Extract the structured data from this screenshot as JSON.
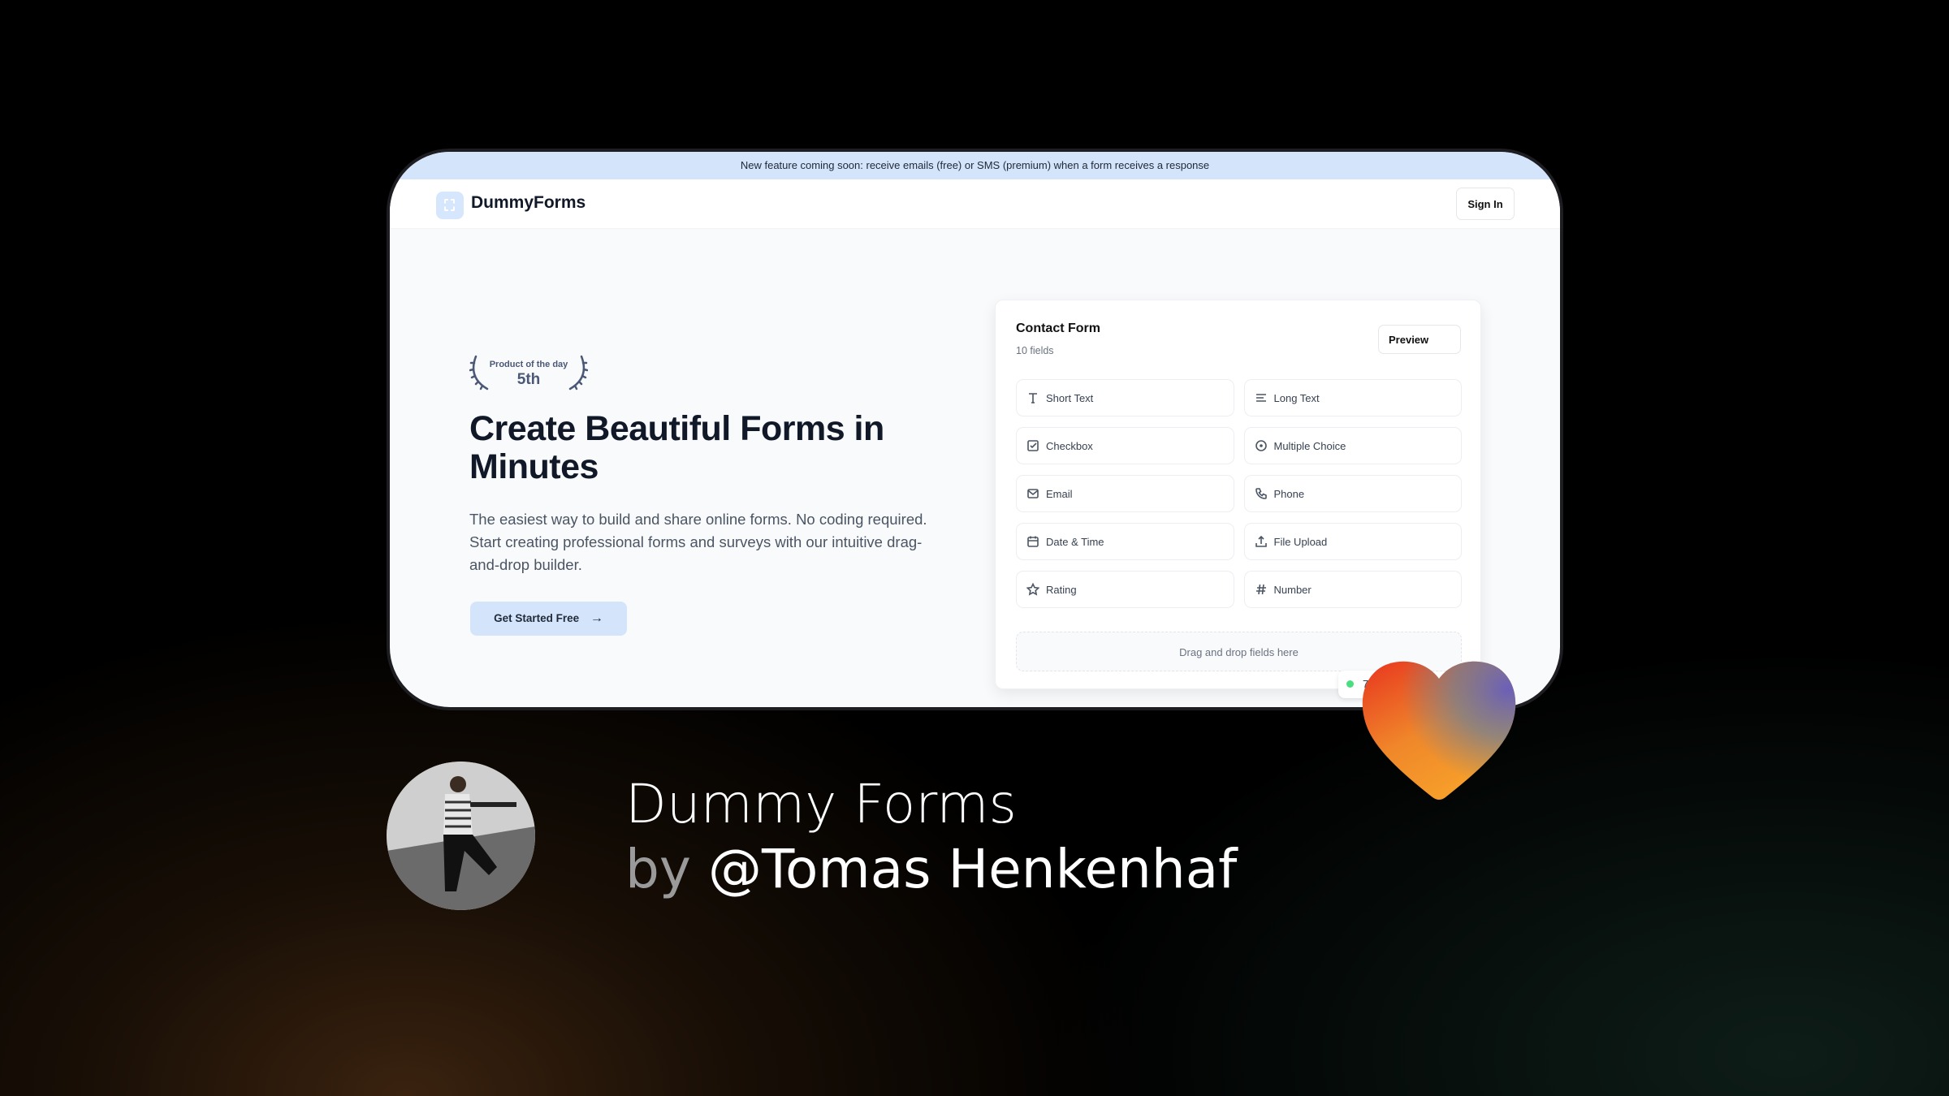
{
  "banner": "New feature coming soon: receive emails (free) or SMS (premium) when a form receives a response",
  "nav": {
    "brand": "DummyForms",
    "signin": "Sign In"
  },
  "hero": {
    "badge_top": "Product of the day",
    "badge_rank": "5th",
    "title": "Create Beautiful Forms in Minutes",
    "description": "The easiest way to build and share online forms. No coding required. Start creating professional forms and surveys with our intuitive drag-and-drop builder.",
    "cta": "Get Started Free"
  },
  "form": {
    "title": "Contact Form",
    "subtitle": "10 fields",
    "preview": "Preview",
    "fields": [
      {
        "label": "Short Text",
        "icon": "text-icon"
      },
      {
        "label": "Long Text",
        "icon": "align-left-icon"
      },
      {
        "label": "Checkbox",
        "icon": "checkbox-icon"
      },
      {
        "label": "Multiple Choice",
        "icon": "radio-icon"
      },
      {
        "label": "Email",
        "icon": "mail-icon"
      },
      {
        "label": "Phone",
        "icon": "phone-icon"
      },
      {
        "label": "Date & Time",
        "icon": "calendar-icon"
      },
      {
        "label": "File Upload",
        "icon": "upload-icon"
      },
      {
        "label": "Rating",
        "icon": "star-icon"
      },
      {
        "label": "Number",
        "icon": "hash-icon"
      }
    ],
    "dropzone": "Drag and drop fields here"
  },
  "status_pill": "7",
  "caption": {
    "product": "Dummy Forms",
    "by": "by",
    "author": "@Tomas Henkenhaf"
  },
  "colors": {
    "accent": "#d3e4fb",
    "status": "#4ade80"
  }
}
